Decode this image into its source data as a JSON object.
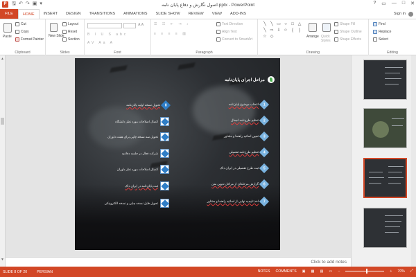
{
  "window": {
    "title": "اصول نگارش و دفاع پایان نامه.pptx - PowerPoint",
    "signin": "Sign in",
    "controls": [
      "?",
      "▭",
      "—",
      "□",
      "✕"
    ]
  },
  "tabs": [
    "FILE",
    "HOME",
    "INSERT",
    "DESIGN",
    "TRANSITIONS",
    "ANIMATIONS",
    "SLIDE SHOW",
    "REVIEW",
    "VIEW",
    "ADD-INS"
  ],
  "ribbon": {
    "clipboard": {
      "label": "Clipboard",
      "paste": "Paste",
      "cut": "Cut",
      "copy": "Copy",
      "format_painter": "Format Painter"
    },
    "slides": {
      "label": "Slides",
      "new_slide": "New Slide",
      "layout": "Layout",
      "reset": "Reset",
      "section": "Section"
    },
    "font": {
      "label": "Font"
    },
    "paragraph": {
      "label": "Paragraph",
      "text_direction": "Text Direction",
      "align_text": "Align Text",
      "convert_smartart": "Convert to SmartArt"
    },
    "drawing": {
      "label": "Drawing",
      "arrange": "Arrange",
      "quick_styles": "Quick Styles",
      "shape_fill": "Shape Fill",
      "shape_outline": "Shape Outline",
      "shape_effects": "Shape Effects"
    },
    "editing": {
      "label": "Editing",
      "find": "Find",
      "replace": "Replace",
      "select": "Select"
    }
  },
  "slide": {
    "title": "مراحل اجرای پایان‌نامه",
    "right_steps": [
      {
        "num": "1",
        "text": "انتخاب موضوع پایان‌نامه"
      },
      {
        "num": "2",
        "text": "تنظیم طرح‌نامه اجمال"
      },
      {
        "num": "3",
        "text": "تعیین اساتید راهنما و مشاور"
      },
      {
        "num": "4",
        "text": "تنظیم طرح‌نامه تفصیلی"
      },
      {
        "num": "5",
        "text": "ثبت طرح تفصیلی در ایران داک"
      },
      {
        "num": "6",
        "text": "گزارش مرحله‌ای از مراحل تدوین متن"
      },
      {
        "num": "7",
        "text": "اخذ تاییدیه نهایی از اساتید راهنما و مشاور"
      }
    ],
    "left_steps": [
      {
        "num": "8",
        "text": "تحویل نسخه اولیه پایان‌نامه"
      },
      {
        "num": "9",
        "text": "اعمال اصلاحات مورد نظر دانشگاه"
      },
      {
        "num": "10",
        "text": "تحویل سه نسخه چاپی برای هیئت داوران"
      },
      {
        "num": "11",
        "text": "شرکت فعال در جلسه دفاعیه"
      },
      {
        "num": "12",
        "text": "اعمال اصلاحات مورد نظر داوران"
      },
      {
        "num": "13",
        "text": "ثبت پایان‌نامه در ایران داک"
      },
      {
        "num": "14",
        "text": "تحویل فایل نسخه چاپی و نسخه الکترونیکی"
      }
    ]
  },
  "notes_placeholder": "Click to add notes",
  "thumbnails": [
    {
      "num": "6",
      "selected": false
    },
    {
      "num": "7",
      "selected": false
    },
    {
      "num": "8",
      "selected": true
    },
    {
      "num": "9",
      "selected": false
    },
    {
      "num": "10",
      "selected": false
    }
  ],
  "status": {
    "slide_info": "SLIDE 8 OF 20",
    "language": "PERSIAN",
    "notes": "NOTES",
    "comments": "COMMENTS",
    "zoom": "70%"
  },
  "colors": {
    "accent": "#d24726",
    "step_blue": "#2f7ec7"
  }
}
